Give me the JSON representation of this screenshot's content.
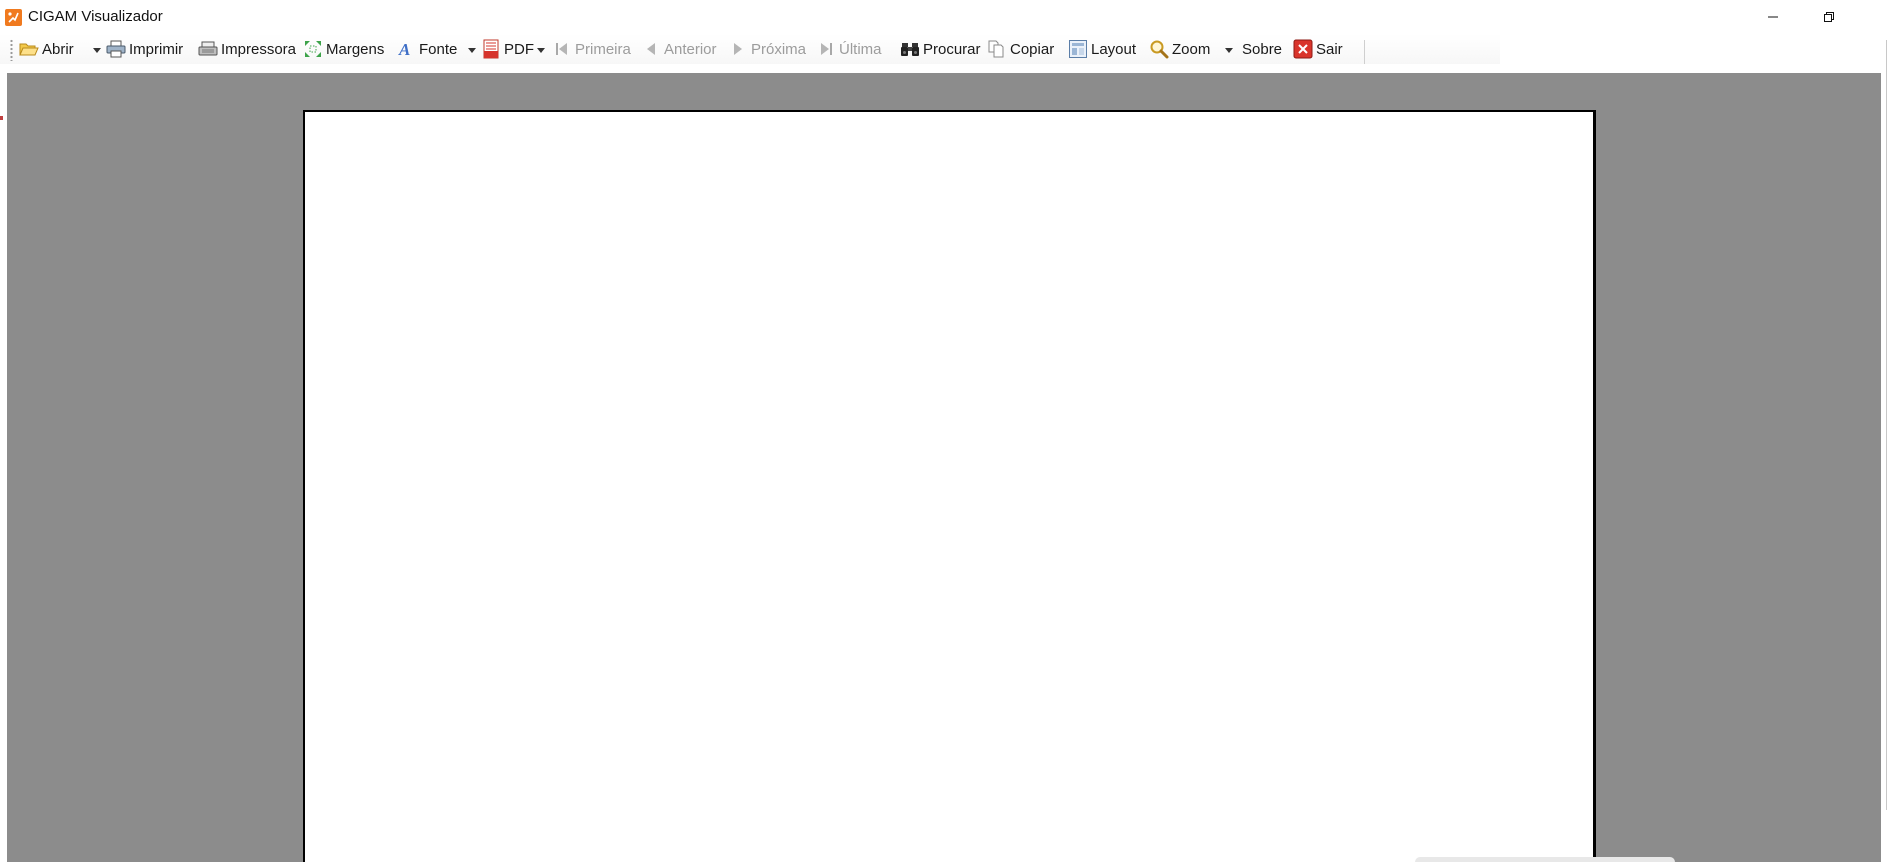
{
  "window": {
    "title": "CIGAM Visualizador",
    "minimize_label": "Minimizar",
    "restore_label": "Restaurar"
  },
  "toolbar": {
    "abrir": "Abrir",
    "imprimir": "Imprimir",
    "impressora": "Impressora",
    "margens": "Margens",
    "fonte": "Fonte",
    "pdf": "PDF",
    "primeira": "Primeira",
    "anterior": "Anterior",
    "proxima": "Próxima",
    "ultima": "Última",
    "procurar": "Procurar",
    "copiar": "Copiar",
    "layout": "Layout",
    "zoom": "Zoom",
    "sobre": "Sobre",
    "sair": "Sair"
  },
  "icons": {
    "app": "cigam-app-icon",
    "abrir": "folder-open-icon",
    "imprimir": "printer-icon",
    "impressora": "printer-setup-icon",
    "margens": "margins-icon",
    "fonte": "font-icon",
    "pdf": "pdf-icon",
    "primeira": "first-page-icon",
    "anterior": "previous-page-icon",
    "proxima": "next-page-icon",
    "ultima": "last-page-icon",
    "procurar": "binoculars-icon",
    "copiar": "copy-icon",
    "layout": "layout-icon",
    "zoom": "magnifier-icon",
    "sair": "exit-icon"
  },
  "colors": {
    "viewer_background": "#8c8c8c",
    "page_background": "#ffffff",
    "app_icon": "#f07a1f",
    "disabled_text": "#9c9c9c"
  }
}
